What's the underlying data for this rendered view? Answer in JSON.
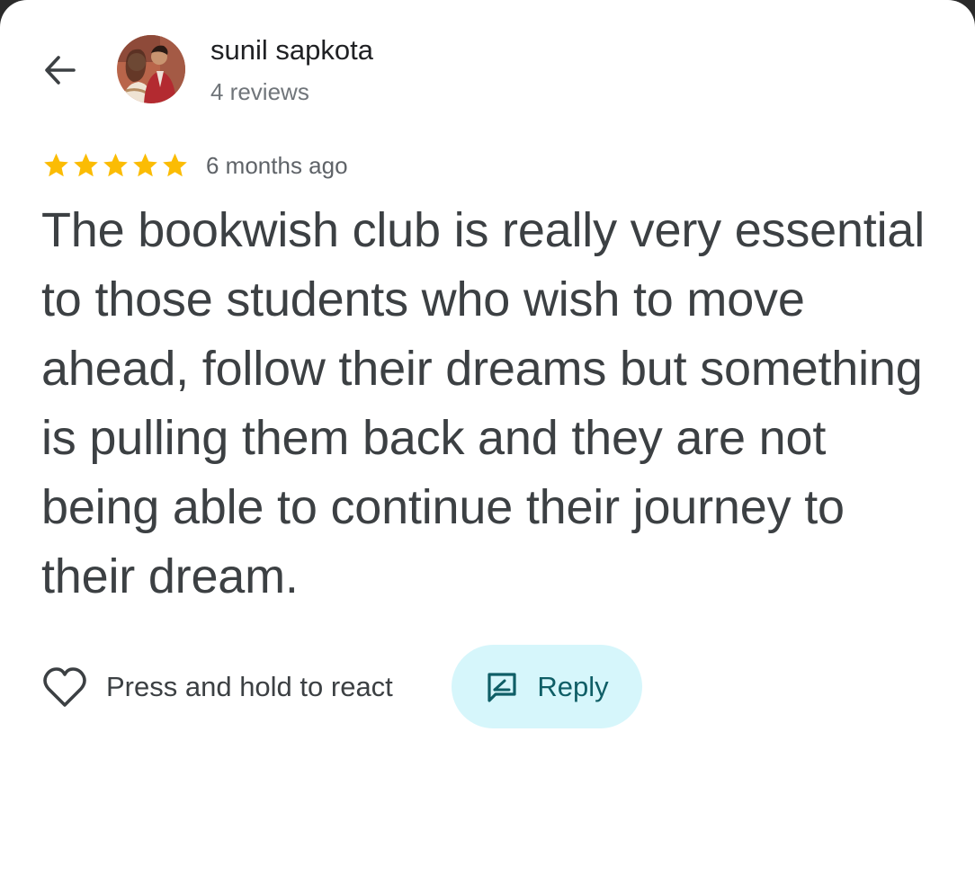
{
  "reviewer": {
    "name": "sunil sapkota",
    "reviews": "4 reviews"
  },
  "review": {
    "rating": 5,
    "rating_max": 5,
    "date": "6 months ago",
    "text": "The bookwish club is really very essential to those students who wish to move ahead, follow their dreams but something is pulling them back and they are not being able to continue their journey to their dream."
  },
  "actions": {
    "react_label": "Press and hold to react",
    "reply_label": "Reply"
  },
  "icons": {
    "back": "arrow-back-icon",
    "star": "star-icon",
    "heart": "heart-outline-icon",
    "reply": "reply-message-icon"
  },
  "colors": {
    "star": "#fbbc04",
    "reply_bg": "#d6f6fb",
    "reply_text": "#0f5e66",
    "text": "#3c4043",
    "muted": "#70757a"
  }
}
